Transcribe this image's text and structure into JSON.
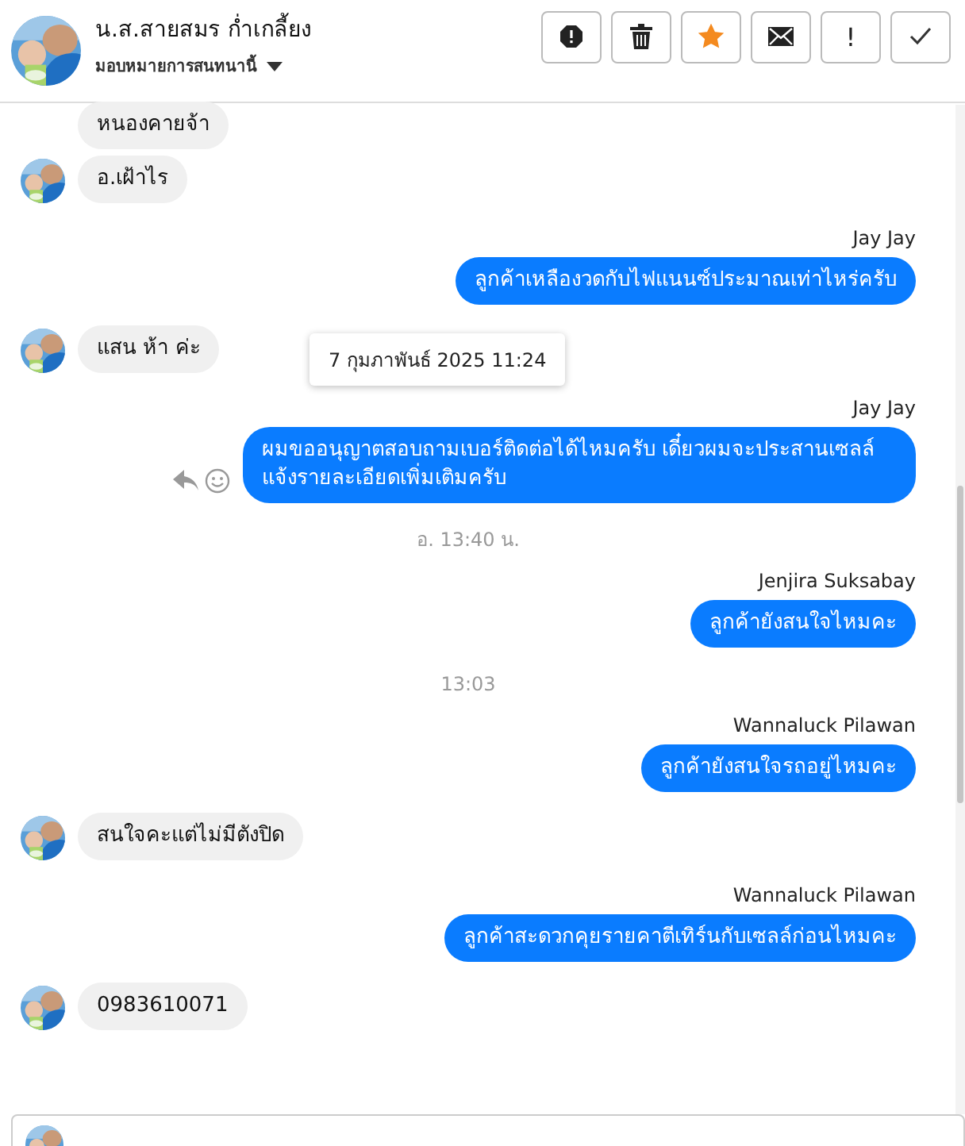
{
  "header": {
    "name": "น.ส.สายสมร ก่ำเกลี้ยง",
    "subtitle": "มอบหมายการสนทนานี้",
    "actions": [
      {
        "kind": "alert"
      },
      {
        "kind": "trash"
      },
      {
        "kind": "star",
        "selected": true
      },
      {
        "kind": "mail"
      },
      {
        "kind": "text",
        "label": "!"
      },
      {
        "kind": "check"
      }
    ]
  },
  "messages": [
    {
      "kind": "incoming",
      "text": "หนองคายจ้า",
      "avatar": false
    },
    {
      "kind": "incoming",
      "text": "อ.เฝ้าไร",
      "avatar": true
    },
    {
      "kind": "outgoing",
      "sender": "Jay Jay",
      "text": "ลูกค้าเหลืองวดกับไฟแนนซ์ประมาณเท่าไหร่ครับ"
    },
    {
      "kind": "incoming",
      "text": "แสน ห้า ค่ะ",
      "avatar": true
    },
    {
      "kind": "outgoing",
      "sender": "Jay Jay",
      "text": "ผมขออนุญาตสอบถามเบอร์ติดต่อได้ไหมครับ เดี๋ยวผมจะประสานเซลล์แจ้งรายละเอียดเพิ่มเติมครับ",
      "tooltip": "7 กุมภาพันธ์ 2025 11:24",
      "hovered": true
    },
    {
      "kind": "time",
      "text": "อ. 13:40 น."
    },
    {
      "kind": "outgoing",
      "sender": "Jenjira Suksabay",
      "text": "ลูกค้ายังสนใจไหมคะ"
    },
    {
      "kind": "time",
      "text": "13:03"
    },
    {
      "kind": "outgoing",
      "sender": "Wannaluck Pilawan",
      "text": "ลูกค้ายังสนใจรถอยู่ไหมคะ"
    },
    {
      "kind": "incoming",
      "text": "สนใจคะแต่ไม่มีตังปิด",
      "avatar": true
    },
    {
      "kind": "outgoing",
      "sender": "Wannaluck Pilawan",
      "text": "ลูกค้าสะดวกคุยรายคาตีเทิร์นกับเซลล์ก่อนไหมคะ"
    },
    {
      "kind": "incoming",
      "text": "0983610071",
      "avatar": true
    }
  ]
}
